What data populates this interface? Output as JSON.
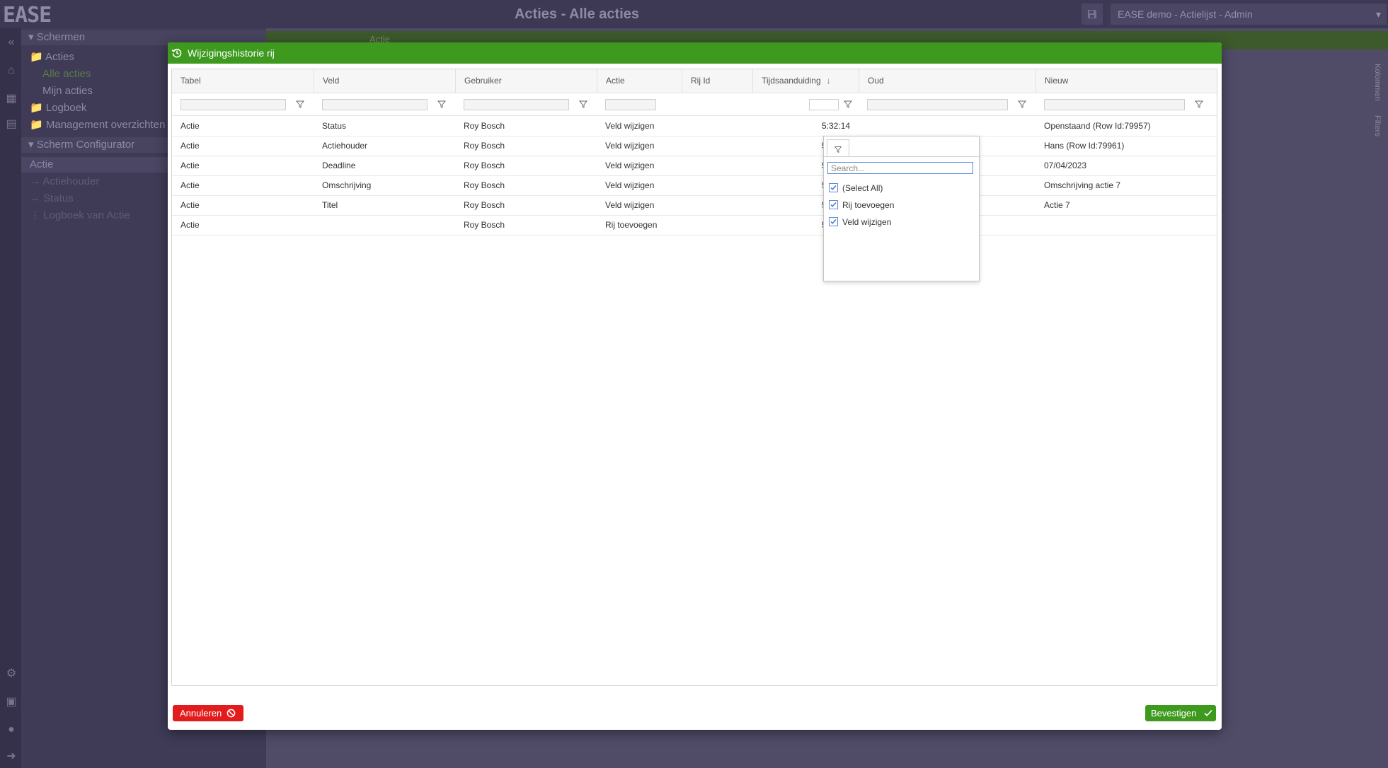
{
  "app": {
    "logo": "EASE",
    "title": "Acties - Alle acties",
    "environment": "EASE demo - Actielijst - Admin"
  },
  "sidebar": {
    "section_screens": "Schermen",
    "items": [
      {
        "label": "Acties"
      },
      {
        "label": "Alle acties"
      },
      {
        "label": "Mijn acties"
      },
      {
        "label": "Logboek"
      },
      {
        "label": "Management overzichten"
      }
    ],
    "section_config": "Scherm Configurator",
    "config_items": [
      {
        "label": "Actie"
      },
      {
        "label": "Actiehouder"
      },
      {
        "label": "Status"
      },
      {
        "label": "Logboek van Actie"
      }
    ]
  },
  "content": {
    "toolbar_label": "Actie",
    "right_tabs": [
      "Kolommen",
      "Filters"
    ]
  },
  "modal": {
    "title": "Wijzigingshistorie rij",
    "columns": [
      {
        "label": "Tabel"
      },
      {
        "label": "Veld"
      },
      {
        "label": "Gebruiker"
      },
      {
        "label": "Actie"
      },
      {
        "label": "Rij Id"
      },
      {
        "label": "Tijdsaanduiding"
      },
      {
        "label": "Oud"
      },
      {
        "label": "Nieuw"
      }
    ],
    "rows": [
      {
        "tabel": "Actie",
        "veld": "Status",
        "gebruiker": "Roy Bosch",
        "actie": "Veld wijzigen",
        "tijd": "5:32:14",
        "oud": "",
        "nieuw": "Openstaand (Row Id:79957)"
      },
      {
        "tabel": "Actie",
        "veld": "Actiehouder",
        "gebruiker": "Roy Bosch",
        "actie": "Veld wijzigen",
        "tijd": "5:32:09",
        "oud": "",
        "nieuw": "Hans (Row Id:79961)"
      },
      {
        "tabel": "Actie",
        "veld": "Deadline",
        "gebruiker": "Roy Bosch",
        "actie": "Veld wijzigen",
        "tijd": "5:32:06",
        "oud": "",
        "nieuw": "07/04/2023"
      },
      {
        "tabel": "Actie",
        "veld": "Omschrijving",
        "gebruiker": "Roy Bosch",
        "actie": "Veld wijzigen",
        "tijd": "5:32:04",
        "oud": "",
        "nieuw": "Omschrijving actie 7"
      },
      {
        "tabel": "Actie",
        "veld": "Titel",
        "gebruiker": "Roy Bosch",
        "actie": "Veld wijzigen",
        "tijd": "5:32:00",
        "oud": "",
        "nieuw": "Actie 7"
      },
      {
        "tabel": "Actie",
        "veld": "",
        "gebruiker": "Roy Bosch",
        "actie": "Rij toevoegen",
        "tijd": "5:31:57",
        "oud": "",
        "nieuw": ""
      }
    ],
    "filter_popup": {
      "search_placeholder": "Search...",
      "options": [
        {
          "label": "(Select All)",
          "checked": true
        },
        {
          "label": "Rij toevoegen",
          "checked": true
        },
        {
          "label": "Veld wijzigen",
          "checked": true
        }
      ]
    },
    "cancel_label": "Annuleren",
    "confirm_label": "Bevestigen"
  },
  "colors": {
    "accent_green": "#3d9a1e",
    "danger_red": "#e21c1c",
    "overlay_purple": "#3a3651"
  },
  "icons": [
    "history-icon",
    "filter-icon",
    "sort-down-icon",
    "ban-icon",
    "check-icon",
    "save-icon"
  ]
}
